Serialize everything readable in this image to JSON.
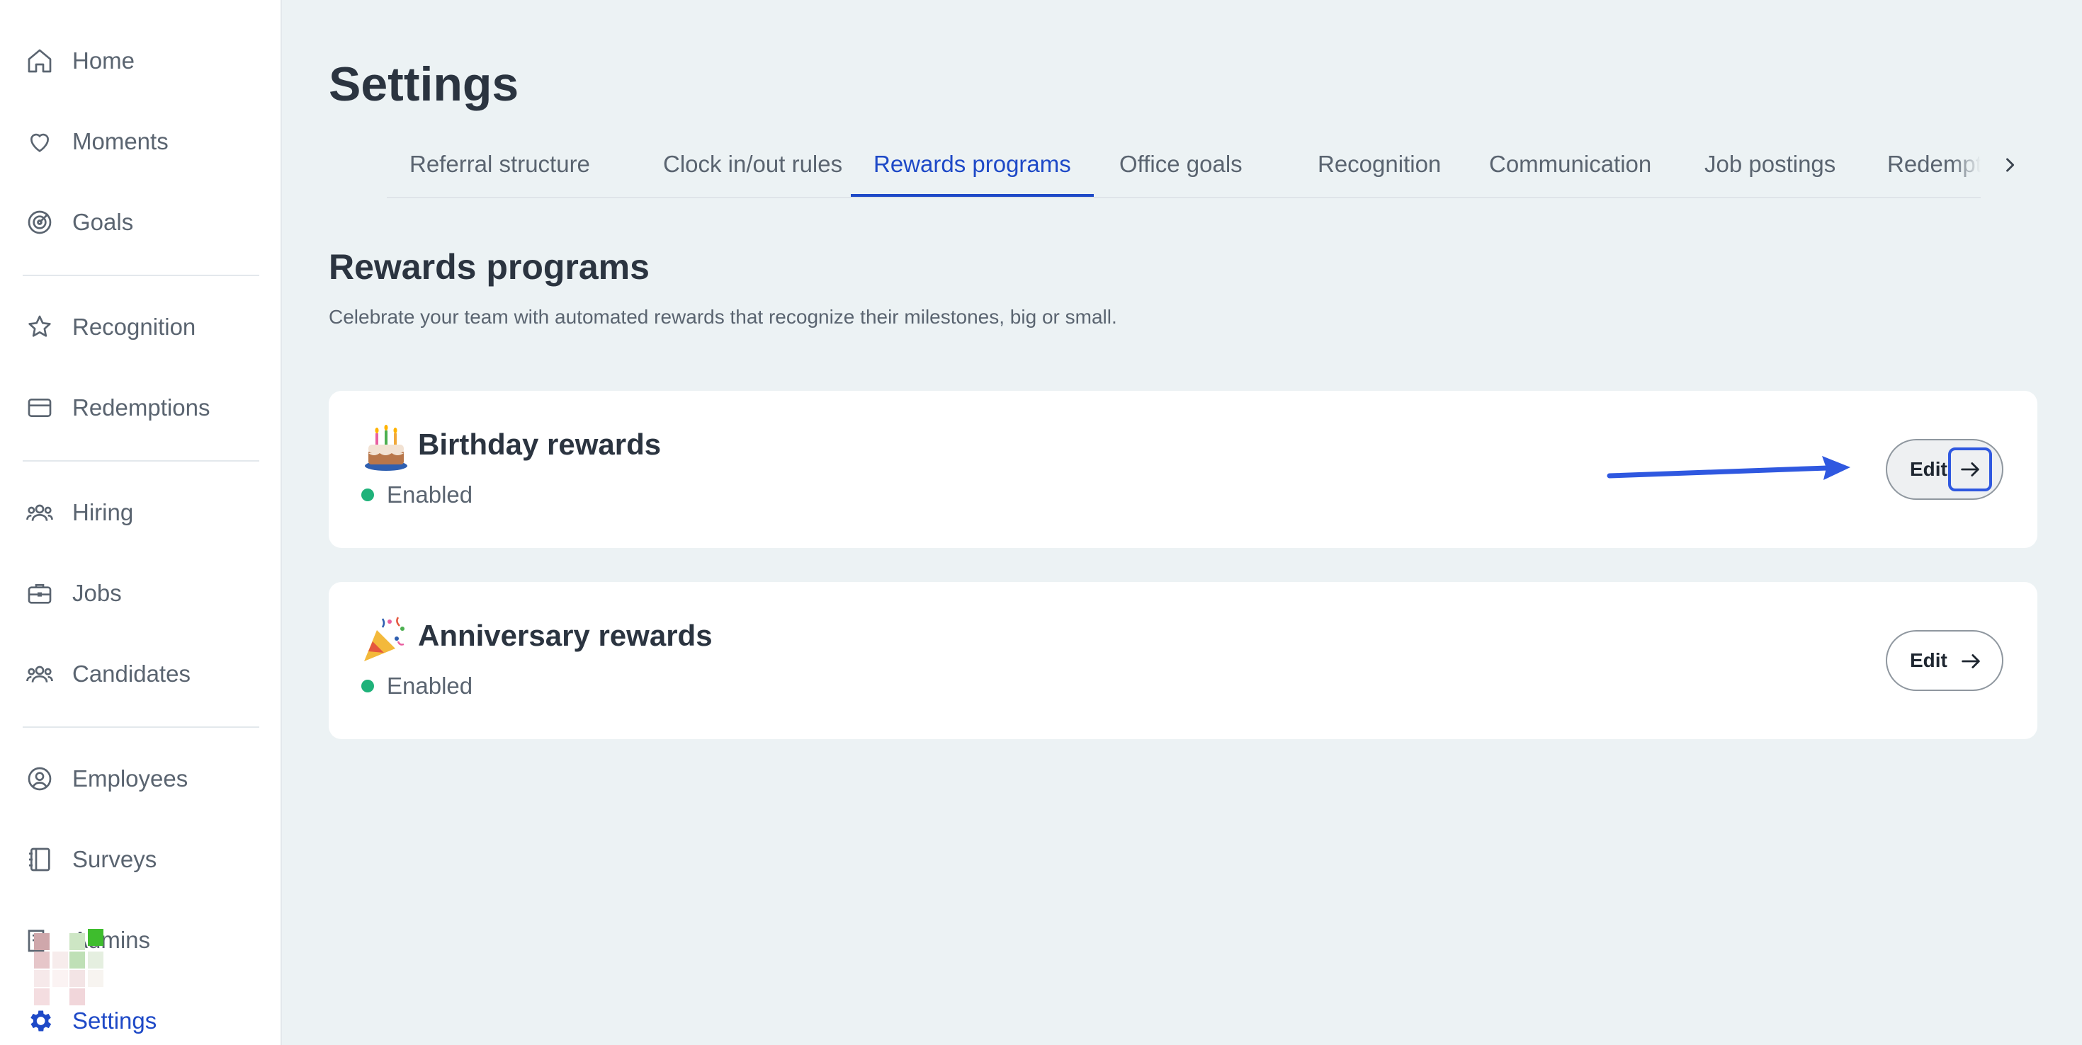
{
  "sidebar": {
    "items": [
      {
        "label": "Home",
        "icon": "home-icon"
      },
      {
        "label": "Moments",
        "icon": "heart-icon"
      },
      {
        "label": "Goals",
        "icon": "target-icon"
      },
      {
        "label": "Recognition",
        "icon": "star-badge-icon"
      },
      {
        "label": "Redemptions",
        "icon": "card-icon"
      },
      {
        "label": "Hiring",
        "icon": "people-icon"
      },
      {
        "label": "Jobs",
        "icon": "briefcase-icon"
      },
      {
        "label": "Candidates",
        "icon": "people-icon"
      },
      {
        "label": "Employees",
        "icon": "user-circle-icon"
      },
      {
        "label": "Surveys",
        "icon": "notebook-icon"
      },
      {
        "label": "Admins",
        "icon": "building-icon"
      },
      {
        "label": "Settings",
        "icon": "gear-icon",
        "active": true
      }
    ]
  },
  "page": {
    "title": "Settings"
  },
  "tabs": [
    {
      "label": "Referral structure"
    },
    {
      "label": "Clock in/out rules"
    },
    {
      "label": "Rewards programs",
      "active": true
    },
    {
      "label": "Office goals"
    },
    {
      "label": "Recognition"
    },
    {
      "label": "Communication"
    },
    {
      "label": "Job postings"
    },
    {
      "label": "Redemptions"
    }
  ],
  "section": {
    "title": "Rewards programs",
    "description": "Celebrate your team with automated rewards that recognize their milestones, big or small."
  },
  "cards": [
    {
      "title": "Birthday rewards",
      "emoji": "birthday-cake-icon",
      "status": "Enabled",
      "edit_label": "Edit"
    },
    {
      "title": "Anniversary rewards",
      "emoji": "party-popper-icon",
      "status": "Enabled",
      "edit_label": "Edit"
    }
  ],
  "colors": {
    "accent": "#1e49c7",
    "enabled": "#1fb27a",
    "background": "#ecf2f4"
  }
}
